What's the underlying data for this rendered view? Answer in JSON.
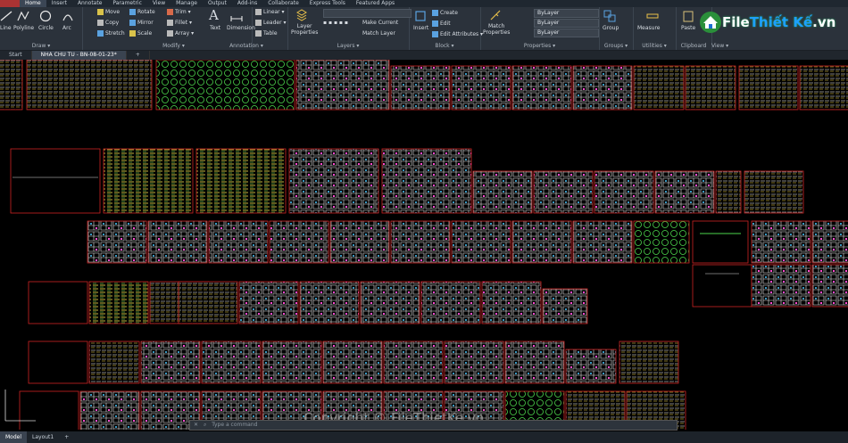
{
  "menu": {
    "tabs": [
      "Home",
      "Insert",
      "Annotate",
      "Parametric",
      "View",
      "Manage",
      "Output",
      "Add-ins",
      "Collaborate",
      "Express Tools",
      "Featured Apps"
    ],
    "active": "Home"
  },
  "ribbon": {
    "draw": {
      "title": "Draw ▾",
      "line": "Line",
      "polyline": "Polyline",
      "circle": "Circle",
      "arc": "Arc"
    },
    "modify": {
      "title": "Modify ▾",
      "move": "Move",
      "rotate": "Rotate",
      "trim": "Trim ▾",
      "copy": "Copy",
      "mirror": "Mirror",
      "fillet": "Fillet ▾",
      "stretch": "Stretch",
      "scale": "Scale",
      "array": "Array ▾"
    },
    "annotation": {
      "title": "Annotation ▾",
      "text": "Text",
      "dimension": "Dimension",
      "linear": "Linear ▾",
      "leader": "Leader ▾",
      "table": "Table"
    },
    "layers": {
      "title": "Layers ▾",
      "layer_properties": "Layer\nProperties",
      "make_current": "Make Current",
      "match_layer": "Match Layer"
    },
    "block": {
      "title": "Block ▾",
      "insert": "Insert",
      "create": "Create",
      "edit": "Edit",
      "edit_attributes": "Edit Attributes ▾"
    },
    "properties": {
      "title": "Properties ▾",
      "match_properties": "Match\nProperties",
      "color": "ByLayer",
      "linetype": "ByLayer",
      "lineweight": "ByLayer"
    },
    "groups": {
      "title": "Groups ▾",
      "group": "Group"
    },
    "utilities": {
      "title": "Utilities ▾",
      "measure": "Measure"
    },
    "clipboard": {
      "title": "Clipboard",
      "paste": "Paste"
    },
    "view": {
      "title": "View ▾"
    }
  },
  "logo": {
    "part1": "File",
    "part2": "Thiết Kế",
    "part3": ".vn"
  },
  "doc_tabs": [
    "Start",
    "NHA CHU TU - BN-08-01-23*"
  ],
  "command": {
    "placeholder": "Type a command"
  },
  "watermark": "Copyright © FileThietKe.vn",
  "layout_tabs": [
    "Model",
    "Layout1"
  ],
  "colors": {
    "sheet_border": "#cc2222",
    "background": "#000000",
    "ribbon": "#2b323b"
  }
}
